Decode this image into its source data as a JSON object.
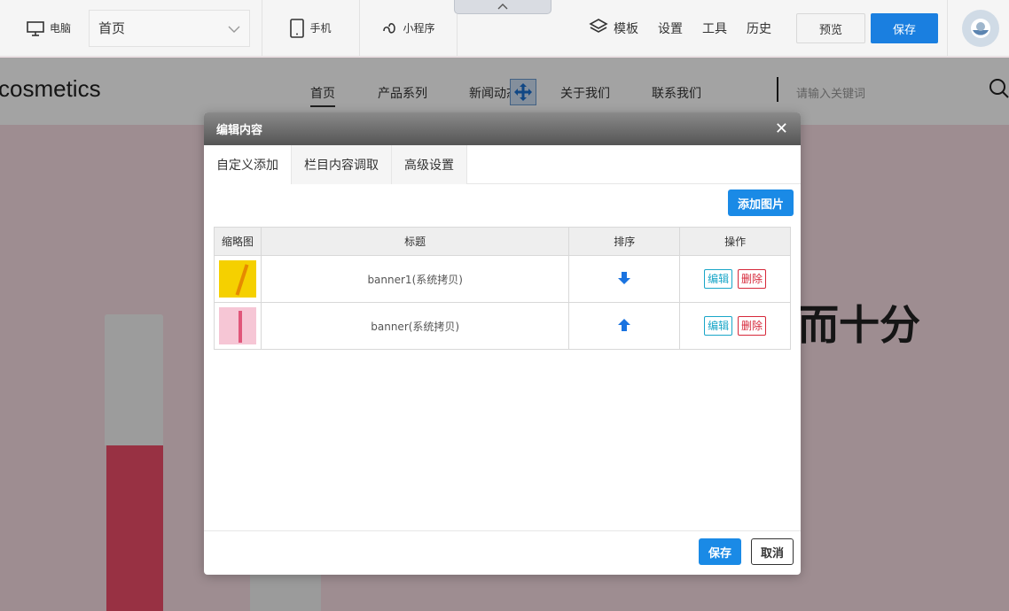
{
  "toolbar": {
    "pc_label": "电脑",
    "page_select_value": "首页",
    "mobile_label": "手机",
    "mini_program_label": "小程序",
    "template_label": "模板",
    "settings_label": "设置",
    "tools_label": "工具",
    "history_label": "历史",
    "preview_label": "预览",
    "save_label": "保存"
  },
  "site": {
    "logo": "cosmetics",
    "nav": [
      "首页",
      "产品系列",
      "新闻动态",
      "关于我们",
      "联系我们"
    ],
    "search_placeholder": "请输入关键词",
    "banner_text": "而十分"
  },
  "modal": {
    "title": "编辑内容",
    "close": "✕",
    "tabs": [
      "自定义添加",
      "栏目内容调取",
      "高级设置"
    ],
    "add_image_label": "添加图片",
    "columns": [
      "缩略图",
      "标题",
      "排序",
      "操作"
    ],
    "rows": [
      {
        "title": "banner1(系统拷贝)",
        "sort": "down",
        "edit": "编辑",
        "delete": "删除"
      },
      {
        "title": "banner(系统拷贝)",
        "sort": "up",
        "edit": "编辑",
        "delete": "删除"
      }
    ],
    "save_label": "保存",
    "cancel_label": "取消"
  },
  "colors": {
    "primary": "#1a8ae6",
    "edit": "#1aa6c8",
    "delete": "#d6283a"
  }
}
